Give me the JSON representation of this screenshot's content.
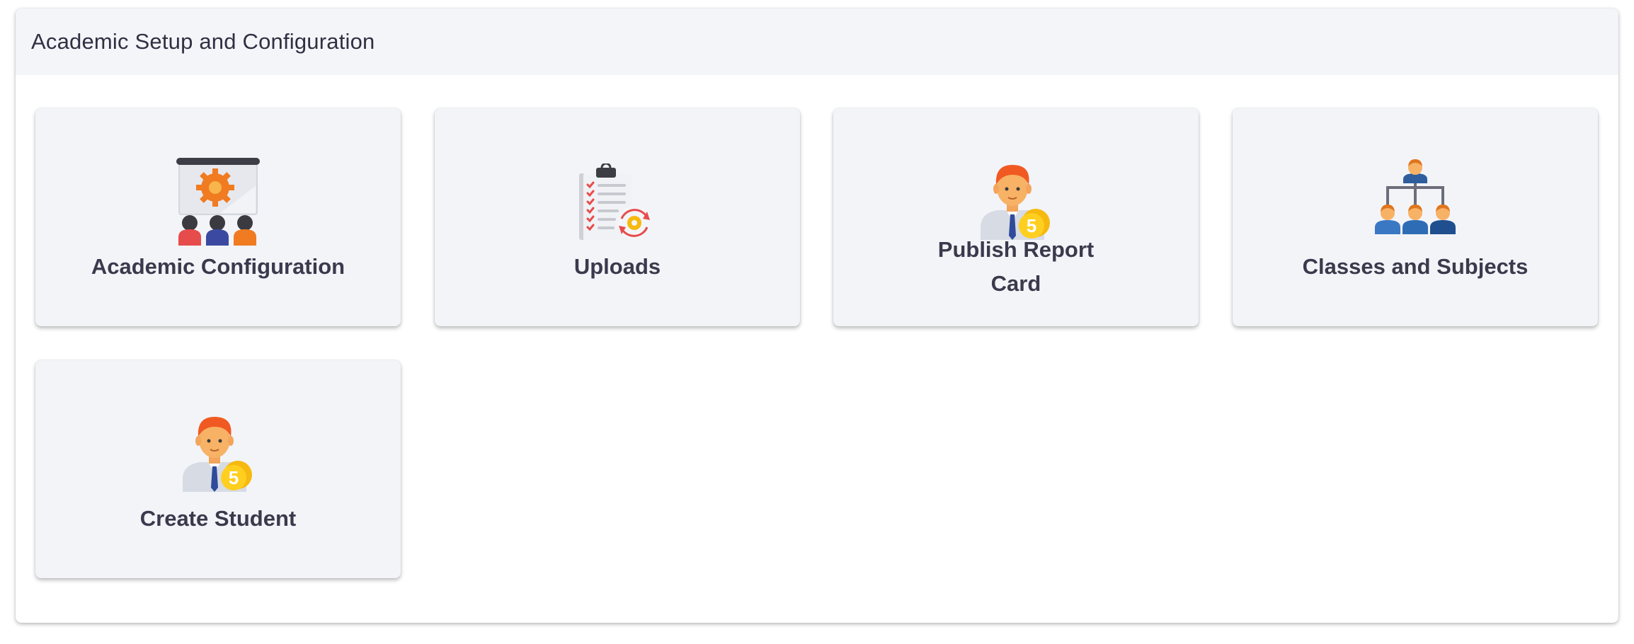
{
  "section": {
    "title": "Academic Setup and Configuration"
  },
  "tiles": [
    {
      "label": "Academic Configuration",
      "icon": "presentation-gear-icon"
    },
    {
      "label": "Uploads",
      "icon": "clipboard-sync-icon"
    },
    {
      "label_line1": "Publish Report",
      "label_line2": "Card",
      "icon": "student-coin-icon"
    },
    {
      "label": "Classes and Subjects",
      "icon": "hierarchy-people-icon"
    },
    {
      "label": "Create Student",
      "icon": "student-coin-icon"
    }
  ],
  "colors": {
    "tile_bg": "#f3f4f8",
    "header_bg": "#f4f5f9",
    "text": "#3a3a4d",
    "accent_orange": "#f07b21",
    "accent_gold": "#f6b90f"
  }
}
